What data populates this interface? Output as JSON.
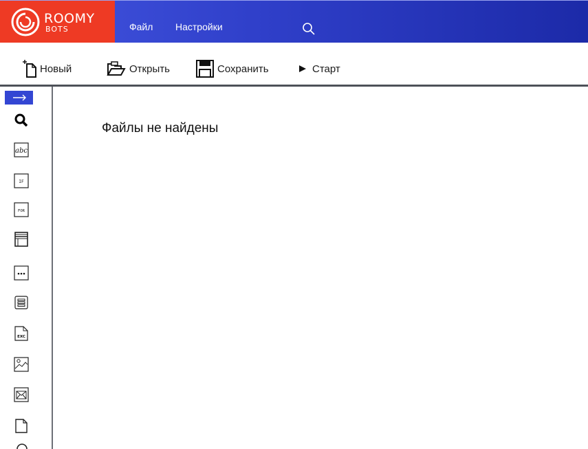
{
  "app": {
    "logo_main": "ROOMY",
    "logo_sub": "BOTS"
  },
  "menu": {
    "file": "Файл",
    "settings": "Настройки"
  },
  "toolbar": {
    "new_label": "Новый",
    "open_label": "Открыть",
    "save_label": "Сохранить",
    "start_label": "Старт"
  },
  "sidebar": {
    "toggle_symbol": "→",
    "tools": [
      {
        "icon": "search-icon"
      },
      {
        "icon": "text-abc-icon",
        "text": "abc"
      },
      {
        "icon": "if-block-icon",
        "text": "IF"
      },
      {
        "icon": "for-loop-icon",
        "text": "FOR"
      },
      {
        "icon": "browser-window-icon"
      },
      {
        "icon": "more-dots-icon"
      },
      {
        "icon": "list-icon"
      },
      {
        "icon": "excel-file-icon",
        "text": "EXC"
      },
      {
        "icon": "image-icon"
      },
      {
        "icon": "email-icon"
      },
      {
        "icon": "file-icon"
      }
    ]
  },
  "main": {
    "empty_message": "Файлы не найдены"
  },
  "colors": {
    "logo_bg": "#ee3a24",
    "titlebar": "#3346d3",
    "accent": "#3346d3"
  }
}
